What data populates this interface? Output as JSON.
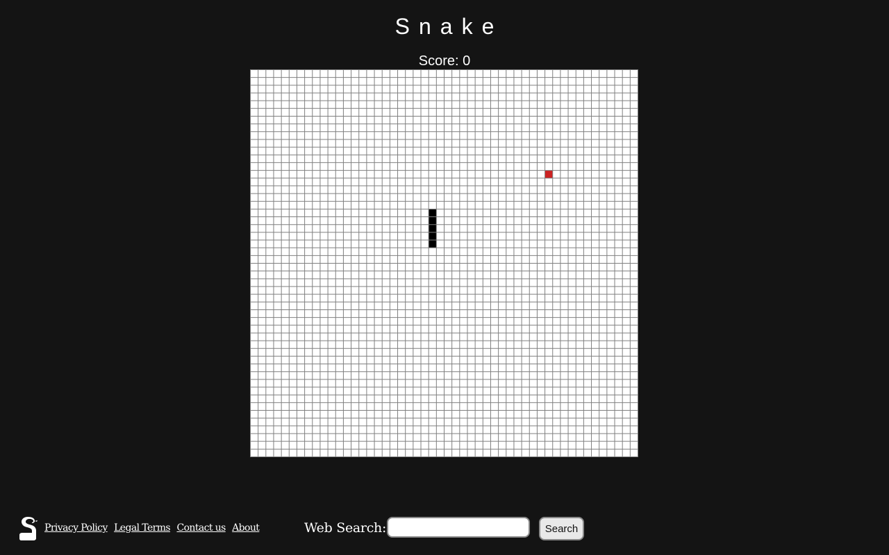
{
  "game": {
    "title": "Snake",
    "score_label": "Score: 0",
    "score": 0,
    "board": {
      "cols": 50,
      "rows": 50,
      "background_color": "#ffffff",
      "grid_color": "#7f7f7f",
      "snake_color": "#000000",
      "food_color": "#cc2222",
      "snake": [
        {
          "col": 23,
          "row": 18
        },
        {
          "col": 23,
          "row": 19
        },
        {
          "col": 23,
          "row": 20
        },
        {
          "col": 23,
          "row": 21
        },
        {
          "col": 23,
          "row": 22
        }
      ],
      "food": {
        "col": 38,
        "row": 13
      }
    }
  },
  "footer": {
    "logo_icon": "snake-logo-icon",
    "links": [
      {
        "label": "Privacy Policy"
      },
      {
        "label": "Legal Terms"
      },
      {
        "label": "Contact us"
      },
      {
        "label": "About"
      }
    ],
    "search": {
      "label": "Web Search:",
      "input_value": "",
      "placeholder": "",
      "button_label": "Search"
    }
  },
  "colors": {
    "page_background": "#141414",
    "text": "#ffffff"
  }
}
